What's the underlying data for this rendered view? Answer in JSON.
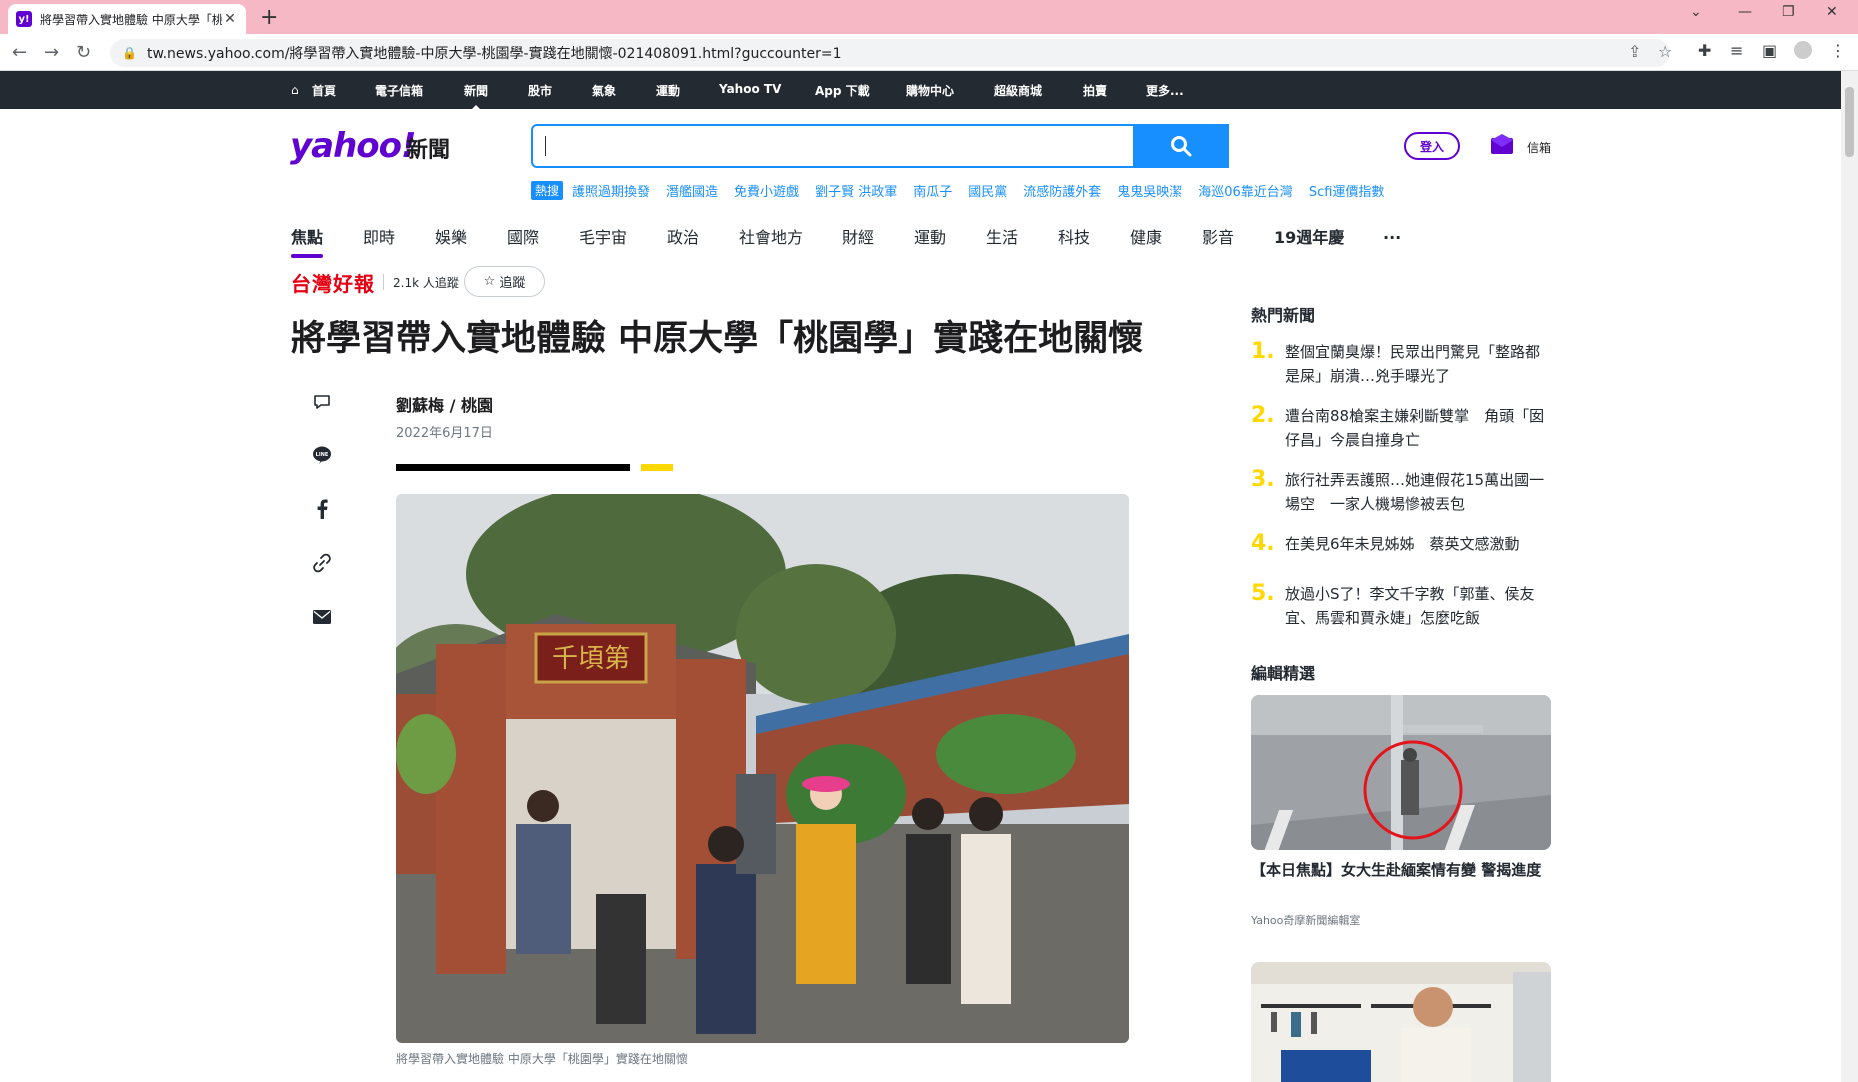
{
  "browser": {
    "tab_title": "將學習帶入實地體驗 中原大學「桃",
    "favicon_text": "y!",
    "url": "tw.news.yahoo.com/將學習帶入實地體驗-中原大學-桃園學-實踐在地關懷-021408091.html?guccounter=1"
  },
  "topnav": {
    "items": [
      "首頁",
      "電子信箱",
      "新聞",
      "股市",
      "氣象",
      "運動",
      "Yahoo TV",
      "App 下載",
      "購物中心",
      "超級商城",
      "拍賣",
      "更多..."
    ],
    "active": "新聞"
  },
  "header": {
    "logo": "yahoo!",
    "logo_sub": "新聞",
    "search_placeholder": "",
    "login_label": "登入",
    "mail_label": "信箱"
  },
  "trending": {
    "badge": "熱搜",
    "terms": [
      "護照過期換發",
      "潛艦國造",
      "免費小遊戲",
      "劉子賢 洪政軍",
      "南瓜子",
      "國民黨",
      "流感防護外套",
      "鬼鬼吳映潔",
      "海巡06靠近台灣",
      "Scfi運價指數"
    ]
  },
  "categories": {
    "items": [
      "焦點",
      "即時",
      "娛樂",
      "國際",
      "毛宇宙",
      "政治",
      "社會地方",
      "財經",
      "運動",
      "生活",
      "科技",
      "健康",
      "影音",
      "19週年慶",
      "..."
    ],
    "selected": "焦點"
  },
  "article": {
    "publisher": "台灣好報",
    "followers": "2.1k 人追蹤",
    "follow_label": "追蹤",
    "headline": "將學習帶入實地體驗 中原大學「桃園學」實踐在地關懷",
    "author": "劉蘇梅 / 桃園",
    "date": "2022年6月17日",
    "caption": "將學習帶入實地體驗 中原大學「桃園學」實踐在地關懷",
    "gate_sign": "千頃第"
  },
  "share_icons": [
    "comment-icon",
    "line-icon",
    "facebook-icon",
    "link-icon",
    "email-icon"
  ],
  "rail": {
    "hot_title": "熱門新聞",
    "hot_news": [
      {
        "num": "1.",
        "text": "整個宜蘭臭爆！民眾出門驚見「整路都是屎」崩潰…兇手曝光了"
      },
      {
        "num": "2.",
        "text": "遭台南88槍案主嫌剁斷雙掌　角頭「囡仔昌」今晨自撞身亡"
      },
      {
        "num": "3.",
        "text": "旅行社弄丟護照…她連假花15萬出國一場空　一家人機場慘被丟包"
      },
      {
        "num": "4.",
        "text": "在美見6年未見姊姊　蔡英文感激動"
      },
      {
        "num": "5.",
        "text": "放過小S了！李文千字教「郭董、侯友宜、馬雲和賈永婕」怎麼吃飯"
      }
    ],
    "picks_title": "編輯精選",
    "pick": {
      "title": "【本日焦點】女大生赴緬案情有變 警揭進度",
      "source": "Yahoo奇摩新聞編輯室"
    }
  }
}
